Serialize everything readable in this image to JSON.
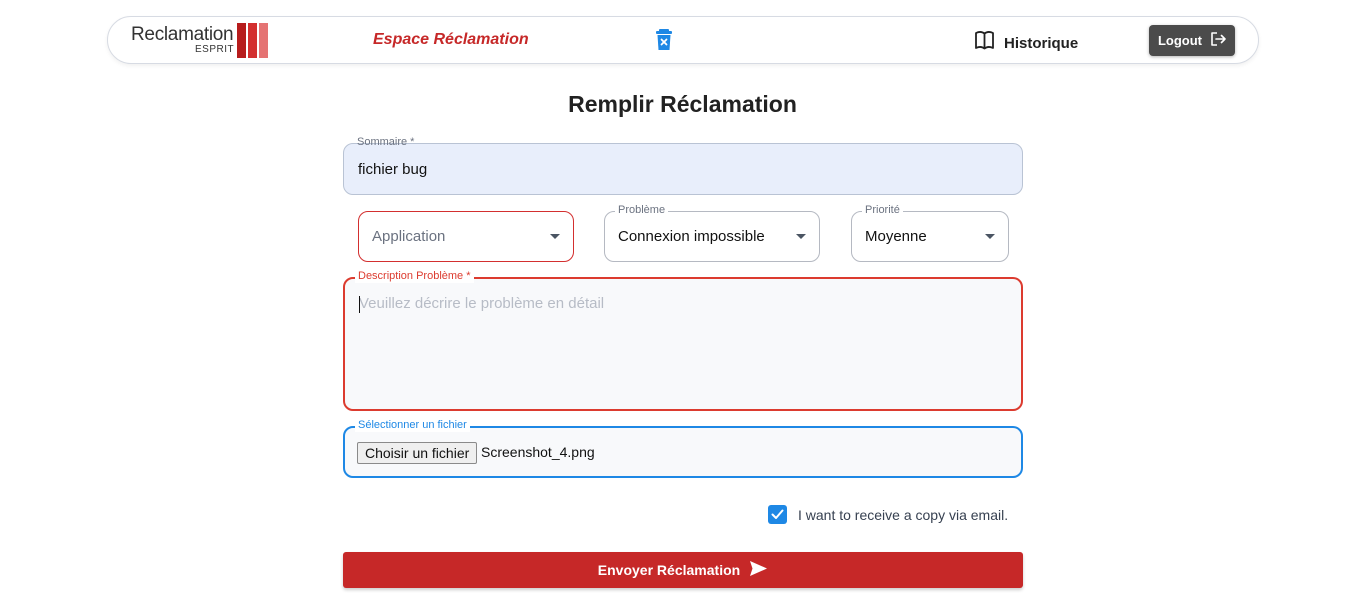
{
  "navbar": {
    "logo_text": "Reclamation",
    "logo_sub": "ESPRIT",
    "logo_colors": [
      "#b71c1c",
      "#d32f2f",
      "#e57373"
    ],
    "espace_label": "Espace Réclamation",
    "trash_icon": "trash-x-icon",
    "historique_label": "Historique",
    "historique_icon": "book-icon",
    "logout_label": "Logout",
    "logout_icon": "logout-icon"
  },
  "page_title": "Remplir Réclamation",
  "form": {
    "sommaire": {
      "label": "Sommaire *",
      "value": "fichier bug"
    },
    "application": {
      "placeholder": "Application"
    },
    "probleme": {
      "label": "Problème",
      "value": "Connexion impossible"
    },
    "priorite": {
      "label": "Priorité",
      "value": "Moyenne"
    },
    "description": {
      "label": "Description Problème *",
      "placeholder": "Veuillez décrire le problème en détail"
    },
    "fichier": {
      "label": "Sélectionner un fichier",
      "button_label": "Choisir un fichier",
      "file_name": "Screenshot_4.png"
    },
    "email_copy": {
      "label": "I want to receive a copy via email.",
      "checked": true
    },
    "submit_label": "Envoyer Réclamation"
  },
  "colors": {
    "accent_red": "#c62828",
    "error_red": "#dc3b2f",
    "focus_blue": "#1e88e5",
    "logout_bg": "#4b4b4b"
  }
}
